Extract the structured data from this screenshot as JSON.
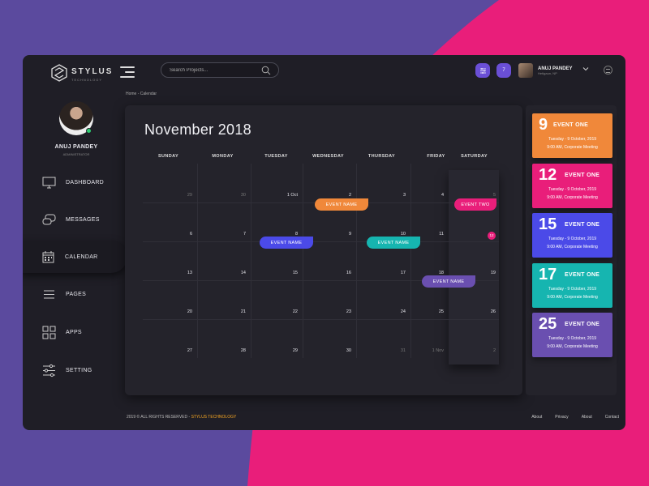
{
  "brand": {
    "name": "STYLUS",
    "tagline": "TECHNOLOGY"
  },
  "header": {
    "search_placeholder": "Search Projects...",
    "notification_count": "7",
    "user": {
      "name": "ANUJ PANDEY",
      "location": "Hetigaun, NP"
    }
  },
  "sidebar": {
    "profile": {
      "name": "ANUJ PANDEY",
      "role": "ADMINISTRATOR"
    },
    "items": [
      {
        "label": "DASHBOARD",
        "icon": "monitor-icon"
      },
      {
        "label": "MESSAGES",
        "icon": "chat-icon"
      },
      {
        "label": "CALENDAR",
        "icon": "calendar-icon",
        "active": true
      },
      {
        "label": "PAGES",
        "icon": "list-icon"
      },
      {
        "label": "APPS",
        "icon": "apps-grid-icon"
      },
      {
        "label": "SETTING",
        "icon": "sliders-icon"
      }
    ]
  },
  "breadcrumb": "Home - Calendar",
  "calendar": {
    "title": "November 2018",
    "weekdays": [
      "SUNDAY",
      "MONDAY",
      "TUESDAY",
      "WEDNESDAY",
      "THURSDAY",
      "FRIDAY",
      "SATURDAY"
    ],
    "weeks": [
      [
        "29",
        "30",
        "1 Oct",
        "2",
        "3",
        "4",
        "5"
      ],
      [
        "6",
        "7",
        "8",
        "9",
        "10",
        "11",
        "12"
      ],
      [
        "13",
        "14",
        "15",
        "16",
        "17",
        "18",
        "19"
      ],
      [
        "20",
        "21",
        "22",
        "23",
        "24",
        "25",
        "26"
      ],
      [
        "27",
        "28",
        "29",
        "30",
        "31",
        "1 Nov",
        "2"
      ]
    ],
    "events": [
      {
        "label": "EVENT NAME",
        "color": "#f0883a"
      },
      {
        "label": "EVENT TWO",
        "color": "#e91e7a"
      },
      {
        "label": "EVENT NAME",
        "color": "#4b4ae8"
      },
      {
        "label": "EVENT NAME",
        "color": "#16b5b0"
      },
      {
        "label": "EVENT NAME",
        "color": "#6a4fb0"
      }
    ]
  },
  "event_cards": [
    {
      "day": "9",
      "title": "EVENT ONE",
      "date": "Tuesday - 9 October, 2019",
      "detail": "9:00 AM, Corporate Meeting",
      "color": "#f0883a"
    },
    {
      "day": "12",
      "title": "EVENT ONE",
      "date": "Tuesday - 9 October, 2019",
      "detail": "9:00 AM, Corporate Meeting",
      "color": "#e91e7a"
    },
    {
      "day": "15",
      "title": "EVENT ONE",
      "date": "Tuesday - 9 October, 2019",
      "detail": "9:00 AM, Corporate Meeting",
      "color": "#4b4ae8"
    },
    {
      "day": "17",
      "title": "EVENT ONE",
      "date": "Tuesday - 9 October, 2019",
      "detail": "9:00 AM, Corporate Meeting",
      "color": "#16b5b0"
    },
    {
      "day": "25",
      "title": "EVENT ONE",
      "date": "Tuesday - 9 October, 2019",
      "detail": "9:00 AM, Corporate Meeting",
      "color": "#6a4fb0"
    }
  ],
  "footer": {
    "copyright": "2019 © ALL RIGHTS RESERVED - ",
    "company": "STYLUS TECHNOLOGY",
    "links": [
      "About",
      "Privacy",
      "About",
      "Contact"
    ]
  }
}
